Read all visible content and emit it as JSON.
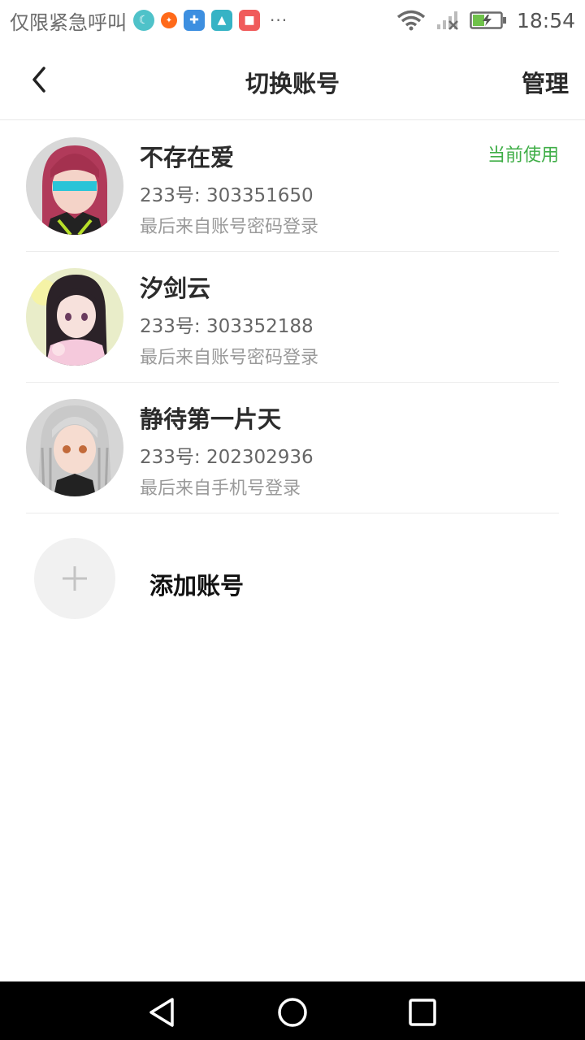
{
  "status_bar": {
    "carrier_text": "仅限紧急呼叫",
    "time": "18:54",
    "more_notifications": "···",
    "notification_icons": [
      "moon-app-icon",
      "weibo-icon",
      "app-icon-blue",
      "app-icon-teal",
      "app-icon-red"
    ],
    "wifi_icon": "wifi-icon",
    "signal_icon": "signal-icon",
    "battery_icon": "battery-charging-icon"
  },
  "header": {
    "title": "切换账号",
    "manage_label": "管理",
    "back_icon": "back-arrow-icon"
  },
  "accounts": [
    {
      "name": "不存在爱",
      "id_line": "233号: 303351650",
      "last_login": "最后来自账号密码登录",
      "current_label": "当前使用",
      "avatar": "avatar-pink-hair"
    },
    {
      "name": "汐剑云",
      "id_line": "233号: 303352188",
      "last_login": "最后来自账号密码登录",
      "avatar": "avatar-dark-hair"
    },
    {
      "name": "静待第一片天",
      "id_line": "233号: 202302936",
      "last_login": "最后来自手机号登录",
      "avatar": "avatar-silver-hair"
    }
  ],
  "add_account": {
    "label": "添加账号",
    "icon": "plus-icon"
  },
  "nav_bar": {
    "back": "nav-back-icon",
    "home": "nav-home-icon",
    "recents": "nav-recents-icon"
  },
  "colors": {
    "accent_green": "#3fae47",
    "text_primary": "#2c2c2c",
    "text_secondary": "#666666",
    "text_tertiary": "#9a9a9a"
  }
}
